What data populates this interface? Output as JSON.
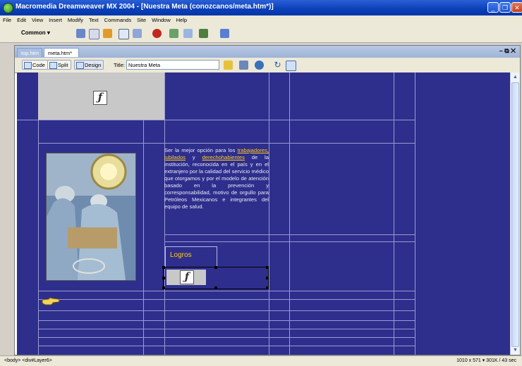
{
  "window": {
    "title": "Macromedia Dreamweaver MX 2004 - [Nuestra Meta (conozcanos/meta.htm*)]"
  },
  "menu": [
    "File",
    "Edit",
    "View",
    "Insert",
    "Modify",
    "Text",
    "Commands",
    "Site",
    "Window",
    "Help"
  ],
  "insert_bar": {
    "category": "Common"
  },
  "tabs": {
    "inactive": "top.htm",
    "active": "meta.htm*"
  },
  "doc_toolbar": {
    "code": "Code",
    "split": "Split",
    "design": "Design",
    "title_label": "Title:",
    "title_value": "Nuestra Meta"
  },
  "content": {
    "para_highlight1": "trabajadores,",
    "para_highlight2": "jubilados",
    "para_y": "y",
    "para_highlight3": "derechohabientes",
    "para_intro": "Ser la mejor opción para los",
    "para_rest": "de la institución, reconocida en el país y en el extranjero por la calidad del servicio médico que otorgamos y por el modelo de atención basado en la prevención y corresponsabilidad, motivo de orgullo para Petróleos Mexicanos e integrantes del equipo de salud.",
    "logros": "Logros"
  },
  "status": {
    "tags": "<body> <div#Layer6>",
    "info": "1010 x 571 ▾ 301K / 43 sec"
  },
  "colors": {
    "canvas": "#2e2e8c",
    "accent": "#ffcc22",
    "titlebar": "#0a3fb8"
  }
}
